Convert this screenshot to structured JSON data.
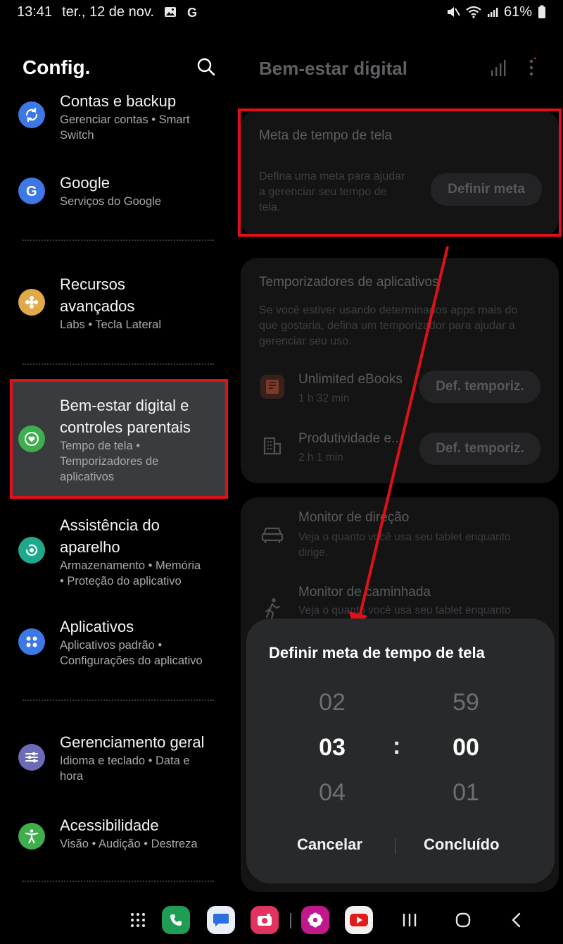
{
  "status_bar": {
    "time": "13:41",
    "date": "ter., 12 de nov.",
    "battery": "61%"
  },
  "left_pane": {
    "title": "Config.",
    "items": [
      {
        "title_line1": "Contas e backup",
        "sub_line1": "Gerenciar contas • Smart",
        "sub_line2": "Switch",
        "color": "#3e78e6",
        "icon": "sync-icon"
      },
      {
        "title_line1": "Google",
        "sub_line1": "Serviços do Google",
        "color": "#3d78e6",
        "icon": "google-icon"
      },
      {
        "title_line1": "Recursos",
        "title_line2": "avançados",
        "sub_line1": "Labs • Tecla Lateral",
        "color": "#e2a94a",
        "icon": "puzzle-icon"
      },
      {
        "title_line1": "Bem-estar digital e",
        "title_line2": "controles parentais",
        "sub_line1": "Tempo de tela •",
        "sub_line2": "Temporizadores de",
        "sub_line3": "aplicativos",
        "color": "#3fae4d",
        "icon": "heart-circle-icon"
      },
      {
        "title_line1": "Assistência do",
        "title_line2": "aparelho",
        "sub_line1": "Armazenamento • Memória",
        "sub_line2": "• Proteção do aplicativo",
        "color": "#1ea98c",
        "icon": "device-care-icon"
      },
      {
        "title_line1": "Aplicativos",
        "sub_line1": "Aplicativos padrão •",
        "sub_line2": "Configurações do aplicativo",
        "color": "#3d78e6",
        "icon": "apps-grid-icon"
      },
      {
        "title_line1": "Gerenciamento geral",
        "sub_line1": "Idioma e teclado • Data e",
        "sub_line2": "hora",
        "color": "#6b6bb8",
        "icon": "sliders-icon"
      },
      {
        "title_line1": "Acessibilidade",
        "sub_line1": "Visão • Audição • Destreza",
        "color": "#3fae4d",
        "icon": "accessibility-icon"
      }
    ]
  },
  "right_pane": {
    "title": "Bem-estar digital",
    "goal_card": {
      "title": "Meta de tempo de tela",
      "desc_line1": "Defina uma meta para ajudar",
      "desc_line2": "a gerenciar seu tempo de",
      "desc_line3": "tela.",
      "button": "Definir meta"
    },
    "timers_card": {
      "title": "Temporizadores de aplicativos",
      "desc_line1": "Se você estiver usando determinados apps mais do",
      "desc_line2": "que gostaria, defina um temporizador para ajudar a",
      "desc_line3": "gerenciar seu uso.",
      "apps": [
        {
          "name": "Unlimited eBooks",
          "time": "1 h 32 min",
          "button": "Def. temporiz."
        },
        {
          "name": "Produtividade e...",
          "time": "2 h 1 min",
          "button": "Def. temporiz."
        }
      ]
    },
    "monitors_card": {
      "driving_title": "Monitor de direção",
      "driving_desc_line1": "Veja o quanto você usa seu tablet enquanto",
      "driving_desc_line2": "dirige.",
      "walking_title": "Monitor de caminhada",
      "walking_desc_line1": "Veja o quanto você usa seu tablet enquanto"
    }
  },
  "dialog": {
    "title": "Definir meta de tempo de tela",
    "hours_prev": "02",
    "hours_current": "03",
    "hours_next": "04",
    "separator": ":",
    "minutes_prev": "59",
    "minutes_current": "00",
    "minutes_next": "01",
    "cancel": "Cancelar",
    "done": "Concluído"
  },
  "colors": {
    "highlight": "#e0101a",
    "dialog_bg": "#28292b"
  }
}
